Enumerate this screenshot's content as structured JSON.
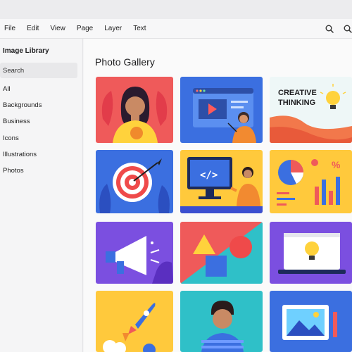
{
  "menubar": {
    "items": [
      "File",
      "Edit",
      "View",
      "Page",
      "Layer",
      "Text"
    ],
    "icons": [
      "search-icon",
      "search-icon"
    ]
  },
  "sidebar": {
    "title": "Image Library",
    "search_placeholder": "Search",
    "categories": [
      "All",
      "Backgrounds",
      "Business",
      "Icons",
      "Illustrations",
      "Photos"
    ]
  },
  "main": {
    "title": "Photo Gallery",
    "tiles": [
      {
        "subject": "woman-portrait",
        "bg": "#ef5a5a"
      },
      {
        "subject": "video-presentation",
        "bg": "#3b6fe0"
      },
      {
        "subject": "creative-thinking",
        "bg": "#eef7f7",
        "text": [
          "CREATIVE",
          "THINKING"
        ]
      },
      {
        "subject": "target",
        "bg": "#3b6fe0"
      },
      {
        "subject": "coding-monitor",
        "bg": "#ffc93c"
      },
      {
        "subject": "charts",
        "bg": "#ffc93c"
      },
      {
        "subject": "megaphone",
        "bg": "#7b4fe0"
      },
      {
        "subject": "shapes",
        "bg": "#ef5a5a"
      },
      {
        "subject": "laptop-idea",
        "bg": "#7b4fe0"
      },
      {
        "subject": "rocket",
        "bg": "#ffc93c"
      },
      {
        "subject": "man-portrait",
        "bg": "#2fc0c8"
      },
      {
        "subject": "image-frame",
        "bg": "#3b6fe0"
      }
    ]
  }
}
